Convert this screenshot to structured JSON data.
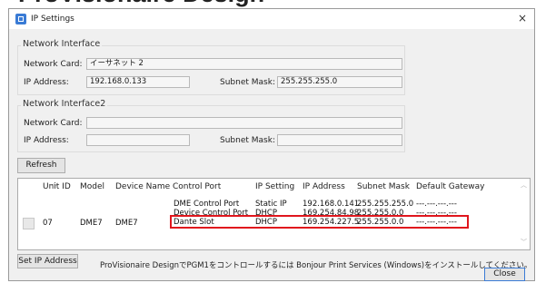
{
  "background_title": "ProVisionaire Design",
  "window": {
    "title": "IP Settings",
    "close_glyph": "×"
  },
  "network_interface": {
    "title": "Network Interface",
    "card_label": "Network Card:",
    "card_value": "イーサネット 2",
    "ip_label": "IP Address:",
    "ip_value": "192.168.0.133",
    "mask_label": "Subnet Mask:",
    "mask_value": "255.255.255.0"
  },
  "network_interface2": {
    "title": "Network Interface2",
    "card_label": "Network Card:",
    "card_value": "",
    "ip_label": "IP Address:",
    "ip_value": "",
    "mask_label": "Subnet Mask:",
    "mask_value": ""
  },
  "refresh_label": "Refresh",
  "table": {
    "headers": [
      "Unit ID",
      "Model",
      "Device Name",
      "Control Port",
      "IP Setting",
      "IP Address",
      "Subnet Mask",
      "Default Gateway"
    ],
    "unit_id": "07",
    "model": "DME7",
    "device_name": "DME7",
    "rows": [
      {
        "control_port": "DME Control Port",
        "ip_setting": "Static IP",
        "ip_address": "192.168.0.141",
        "subnet_mask": "255.255.255.0",
        "gateway": "---.---.---.---"
      },
      {
        "control_port": "Device Control Port",
        "ip_setting": "DHCP",
        "ip_address": "169.254.84.98",
        "subnet_mask": "255.255.0.0",
        "gateway": "---.---.---.---"
      },
      {
        "control_port": "Dante Slot",
        "ip_setting": "DHCP",
        "ip_address": "169.254.227.5",
        "subnet_mask": "255.255.0.0",
        "gateway": "---.---.---.---"
      }
    ]
  },
  "set_ip_label": "Set IP Address",
  "notice": "ProVisionaire DesignでPGM1をコントロールするには Bonjour Print Services (Windows)をインストールしてください。",
  "close_label": "Close",
  "colors": {
    "highlight": "#e0161d",
    "dialog_bg": "#f0f0f0",
    "accent": "#3a7bd5"
  }
}
